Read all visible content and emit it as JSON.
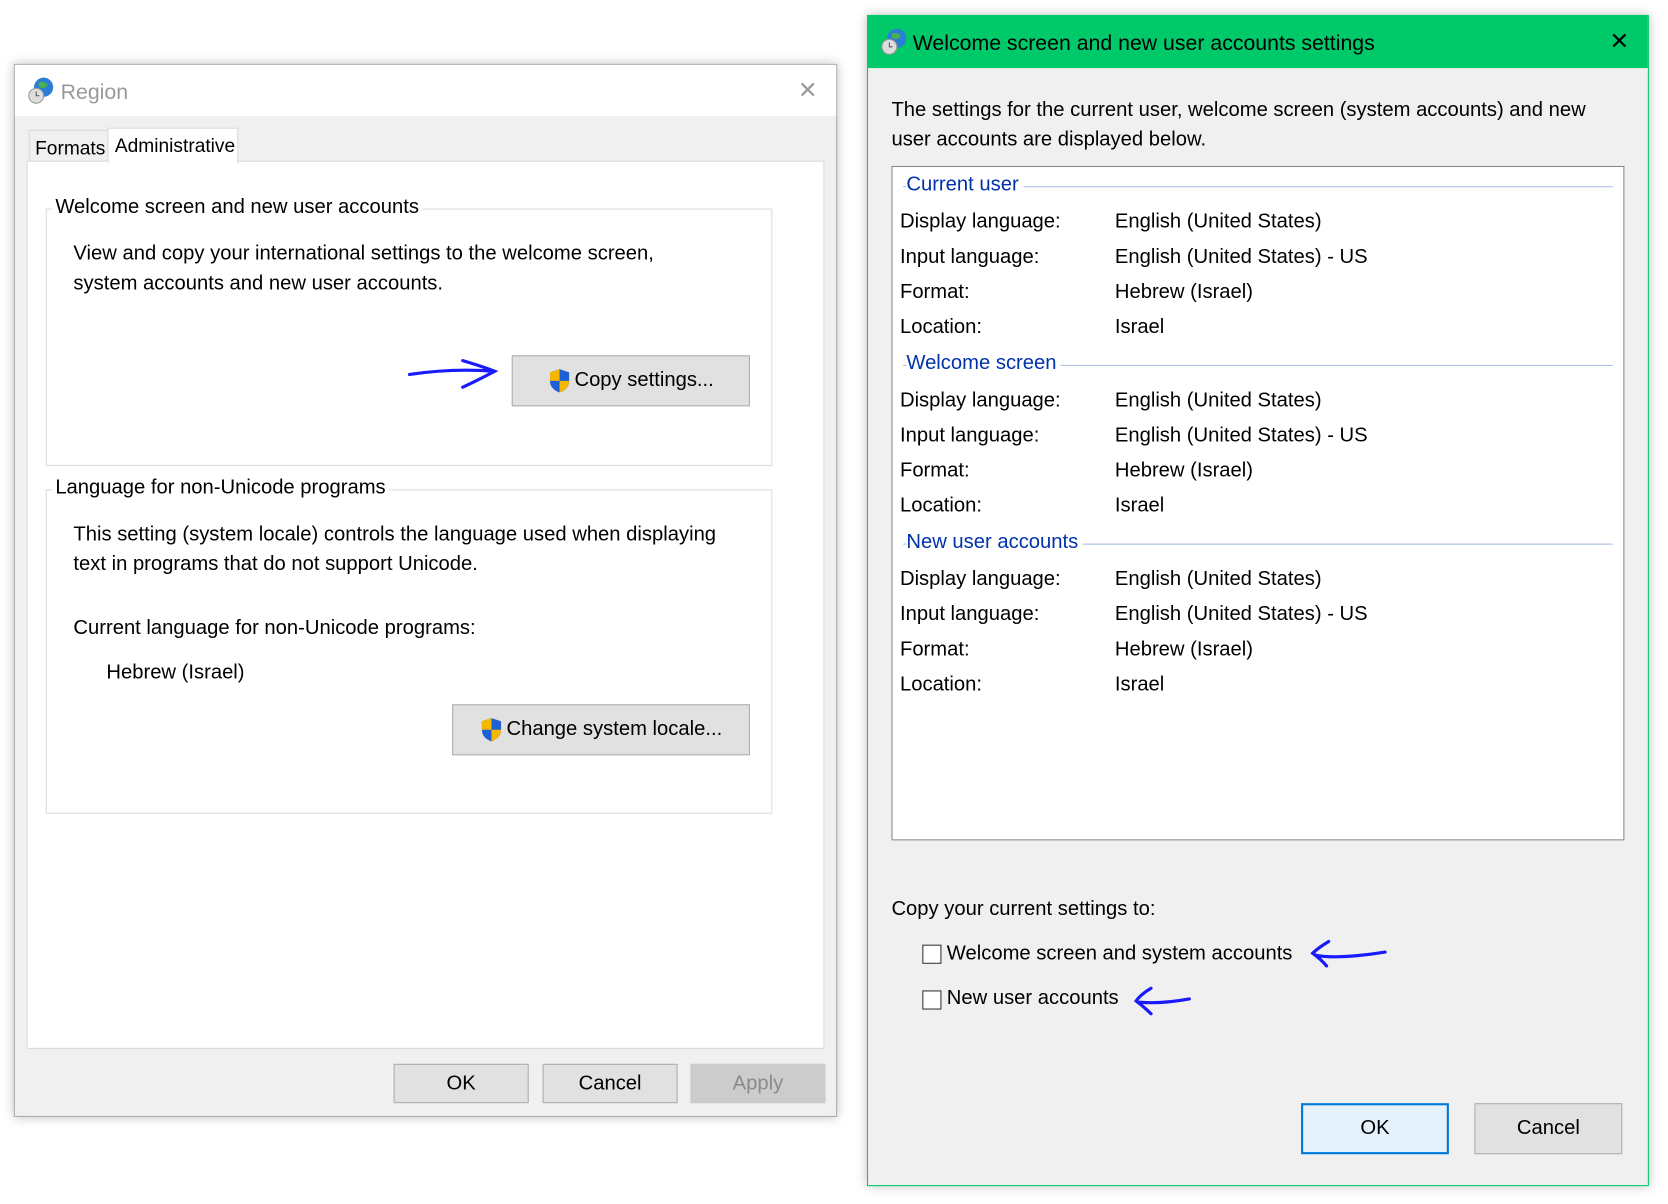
{
  "region_window": {
    "title": "Region",
    "tabs": [
      {
        "label": "Formats",
        "active": false
      },
      {
        "label": "Administrative",
        "active": true
      }
    ],
    "group1": {
      "label": "Welcome screen and new user accounts",
      "desc_lines": [
        "View and copy your international settings to the welcome screen,",
        "system accounts and new user accounts."
      ],
      "button": "Copy settings..."
    },
    "group2": {
      "label": "Language for non-Unicode programs",
      "desc_lines": [
        "This setting (system locale) controls the language used when displaying",
        "text in programs that do not support Unicode."
      ],
      "current_label": "Current language for non-Unicode programs:",
      "current_value": "Hebrew (Israel)",
      "button": "Change system locale..."
    },
    "buttons": {
      "ok": "OK",
      "cancel": "Cancel",
      "apply": "Apply"
    }
  },
  "settings_window": {
    "title": "Welcome screen and new user accounts settings",
    "title_bar_color": "#00c96a",
    "intro_lines": [
      "The settings for the current user, welcome screen (system accounts) and new",
      "user accounts are displayed below."
    ],
    "sections": [
      {
        "heading": "Current user",
        "rows": [
          {
            "label": "Display language:",
            "value": "English (United States)"
          },
          {
            "label": "Input language:",
            "value": "English (United States) - US"
          },
          {
            "label": "Format:",
            "value": "Hebrew (Israel)"
          },
          {
            "label": "Location:",
            "value": "Israel"
          }
        ]
      },
      {
        "heading": "Welcome screen",
        "rows": [
          {
            "label": "Display language:",
            "value": "English (United States)"
          },
          {
            "label": "Input language:",
            "value": "English (United States) - US"
          },
          {
            "label": "Format:",
            "value": "Hebrew (Israel)"
          },
          {
            "label": "Location:",
            "value": "Israel"
          }
        ]
      },
      {
        "heading": "New user accounts",
        "rows": [
          {
            "label": "Display language:",
            "value": "English (United States)"
          },
          {
            "label": "Input language:",
            "value": "English (United States) - US"
          },
          {
            "label": "Format:",
            "value": "Hebrew (Israel)"
          },
          {
            "label": "Location:",
            "value": "Israel"
          }
        ]
      }
    ],
    "copy_label": "Copy your current settings to:",
    "checkboxes": [
      {
        "label": "Welcome screen and system accounts",
        "checked": false
      },
      {
        "label": "New user accounts",
        "checked": false
      }
    ],
    "buttons": {
      "ok": "OK",
      "cancel": "Cancel"
    }
  },
  "annotation_color": "#1a1aff"
}
